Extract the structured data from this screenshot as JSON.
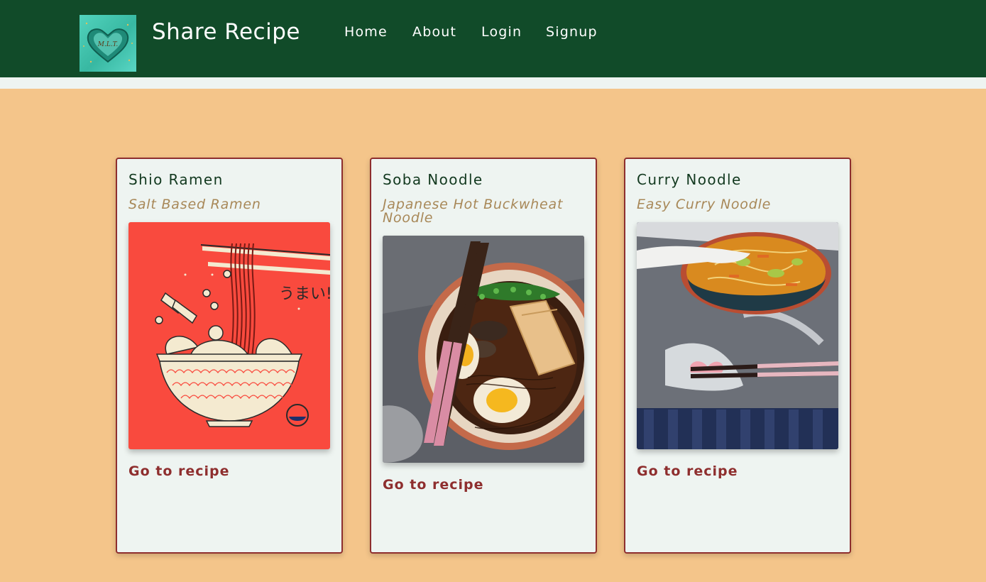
{
  "header": {
    "brand": "Share Recipe",
    "logo_text": "M.L.T.",
    "nav": [
      "Home",
      "About",
      "Login",
      "Signup"
    ]
  },
  "recipes": [
    {
      "title": "Shio Ramen",
      "subtitle": "Salt Based Ramen",
      "link": "Go to recipe",
      "image_text": "うまい!"
    },
    {
      "title": "Soba Noodle",
      "subtitle": "Japanese Hot Buckwheat Noodle",
      "link": "Go to recipe"
    },
    {
      "title": "Curry Noodle",
      "subtitle": "Easy Curry Noodle",
      "link": "Go to recipe"
    }
  ],
  "colors": {
    "navbar": "#114b29",
    "page_background": "#f4c58a",
    "card_background": "#eef4f1",
    "card_border": "#8e2e2e",
    "title": "#12391f",
    "subtitle": "#a88858",
    "link": "#8e2e2e"
  }
}
